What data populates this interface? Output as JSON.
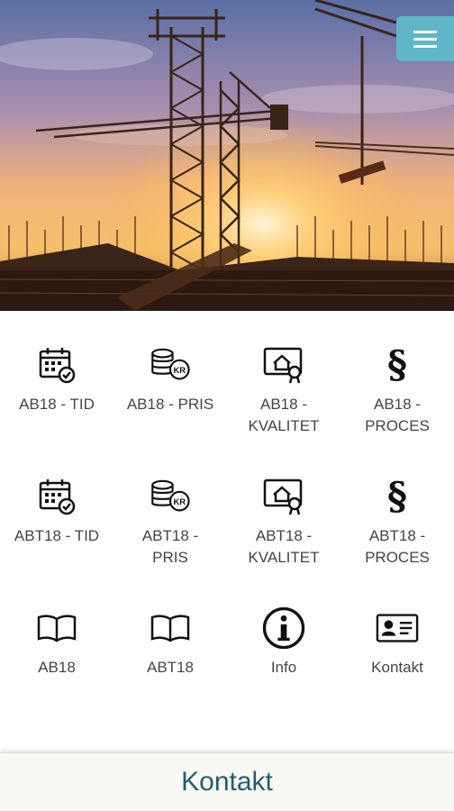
{
  "colors": {
    "accent": "#5fb6c7",
    "footer_text": "#1e5f74",
    "label": "#444444"
  },
  "header": {
    "menu_icon": "hamburger-icon"
  },
  "tiles": [
    {
      "label": "AB18 - TID",
      "icon": "calendar-check-icon"
    },
    {
      "label": "AB18 - PRIS",
      "icon": "coins-kr-icon"
    },
    {
      "label": "AB18 -\nKVALITET",
      "icon": "certificate-house-icon"
    },
    {
      "label": "AB18 -\nPROCES",
      "icon": "paragraph-icon"
    },
    {
      "label": "ABT18 - TID",
      "icon": "calendar-check-icon"
    },
    {
      "label": "ABT18 -\nPRIS",
      "icon": "coins-kr-icon"
    },
    {
      "label": "ABT18 -\nKVALITET",
      "icon": "certificate-house-icon"
    },
    {
      "label": "ABT18 -\nPROCES",
      "icon": "paragraph-icon"
    },
    {
      "label": "AB18",
      "icon": "open-book-icon"
    },
    {
      "label": "ABT18",
      "icon": "open-book-icon"
    },
    {
      "label": "Info",
      "icon": "info-icon"
    },
    {
      "label": "Kontakt",
      "icon": "contact-card-icon"
    }
  ],
  "footer": {
    "label": "Kontakt"
  }
}
